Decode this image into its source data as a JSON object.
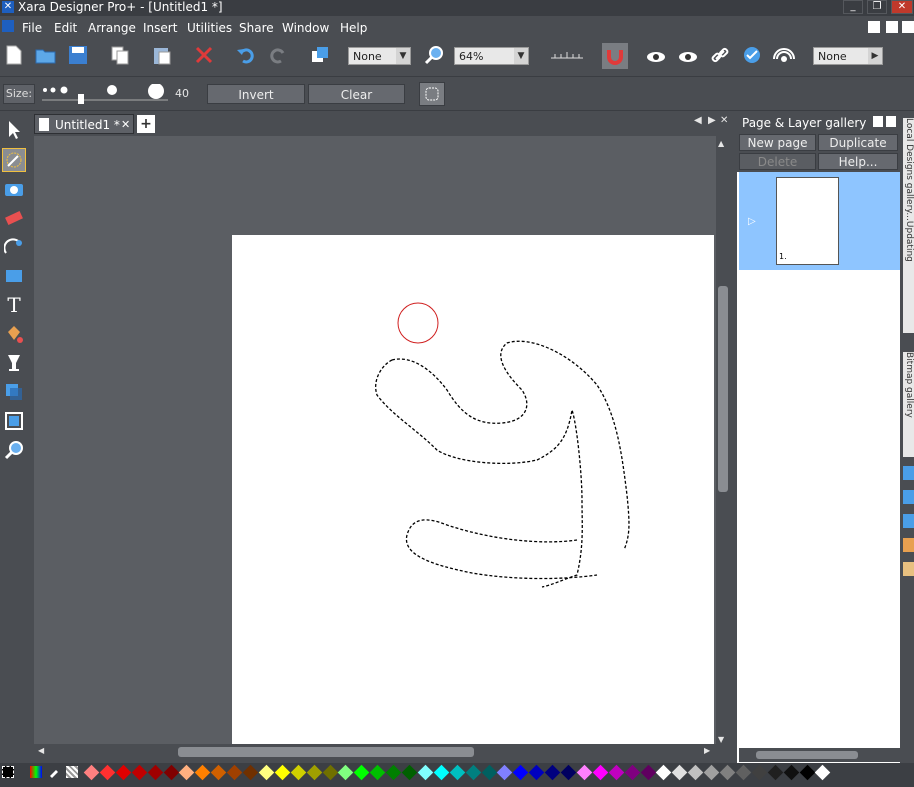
{
  "window": {
    "title": "Xara Designer Pro+ - [Untitled1 *]",
    "minimize": "_",
    "restore": "❐",
    "close": "✕"
  },
  "menu": [
    "File",
    "Edit",
    "Arrange",
    "Insert",
    "Utilities",
    "Share",
    "Window",
    "Help"
  ],
  "toolbar": {
    "fill_combo": "None",
    "zoom_combo": "64%",
    "right_combo": "None"
  },
  "infobar": {
    "size_label": "Size:",
    "size_value": "40",
    "invert_label": "Invert",
    "clear_label": "Clear"
  },
  "document": {
    "tab_label": "Untitled1 *",
    "tab_close": "✕",
    "new_tab": "+"
  },
  "gallery": {
    "title": "Page & Layer gallery",
    "new_page": "New page",
    "duplicate": "Duplicate",
    "delete": "Delete",
    "help": "Help...",
    "page_number": "1."
  },
  "side_tabs": {
    "local_designs": "Local Designs gallery...Updating",
    "bitmap": "Bitmap gallery"
  },
  "colors": {
    "accent": "#8ec5ff",
    "palette": [
      "#ff8080",
      "#ff3030",
      "#e00000",
      "#c00000",
      "#a00000",
      "#800000",
      "#ffb080",
      "#ff8000",
      "#d06000",
      "#a04000",
      "#703000",
      "#ffff80",
      "#ffff00",
      "#d0d000",
      "#a0a000",
      "#707000",
      "#80ff80",
      "#00ff00",
      "#00c000",
      "#008000",
      "#006000",
      "#80ffff",
      "#00ffff",
      "#00c0c0",
      "#008080",
      "#006060",
      "#8080ff",
      "#0000ff",
      "#0000c0",
      "#000080",
      "#000060",
      "#ff80ff",
      "#ff00ff",
      "#c000c0",
      "#800080",
      "#600060",
      "#ffffff",
      "#e0e0e0",
      "#c0c0c0",
      "#a0a0a0",
      "#808080",
      "#606060",
      "#404040",
      "#202020",
      "#101010",
      "#000000",
      "#ffffff"
    ]
  }
}
